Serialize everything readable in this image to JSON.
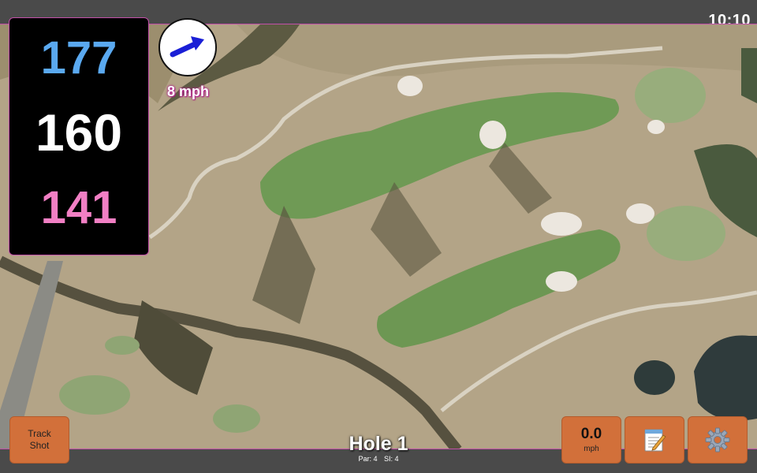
{
  "status": {
    "time": "10:10"
  },
  "distances": {
    "back": "177",
    "center": "160",
    "front": "141"
  },
  "wind": {
    "speed": "8 mph",
    "icon": "wind-direction-arrow-icon"
  },
  "hole": {
    "title": "Hole 1",
    "par": "Par: 4",
    "si": "SI: 4"
  },
  "buttons": {
    "track_shot": "Track\nShot",
    "speed_value": "0.0",
    "speed_unit": "mph",
    "notes_icon": "notepad-icon",
    "settings_icon": "gear-icon"
  },
  "colors": {
    "back_distance": "#5aa9f0",
    "center_distance": "#ffffff",
    "front_distance": "#f17fc4",
    "button": "#d2703a",
    "accent": "#c24fa8"
  }
}
